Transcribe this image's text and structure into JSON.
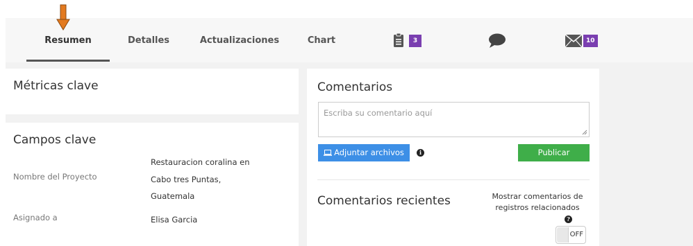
{
  "tabs": [
    {
      "label": "Resumen",
      "active": true
    },
    {
      "label": "Detalles",
      "active": false
    },
    {
      "label": "Actualizaciones",
      "active": false
    },
    {
      "label": "Chart",
      "active": false
    }
  ],
  "icon_tabs": [
    {
      "icon": "clipboard-icon",
      "badge": "3"
    },
    {
      "icon": "chat-bubble-icon",
      "badge": ""
    },
    {
      "icon": "envelope-icon",
      "badge": "10"
    }
  ],
  "metrics": {
    "title": "Métricas clave"
  },
  "key_fields": {
    "title": "Campos clave",
    "project_label": "Nombre del Proyecto",
    "project_value_lines": [
      "Restauracion coralina en",
      "Cabo tres Puntas,",
      "Guatemala"
    ],
    "assigned_label": "Asignado a",
    "assigned_value": "Elisa Garcia"
  },
  "comments": {
    "title": "Comentarios",
    "placeholder": "Escriba su comentario aquí",
    "attach_label": "Adjuntar archivos",
    "publish_label": "Publicar",
    "recent_title": "Comentarios recientes",
    "related_text": "Mostrar comentarios de registros relacionados",
    "toggle_label": "OFF"
  },
  "colors": {
    "badge": "#7a3fb0",
    "attach_button": "#3d8fe6",
    "publish_button": "#3fae49",
    "arrow": "#e37a1f"
  }
}
